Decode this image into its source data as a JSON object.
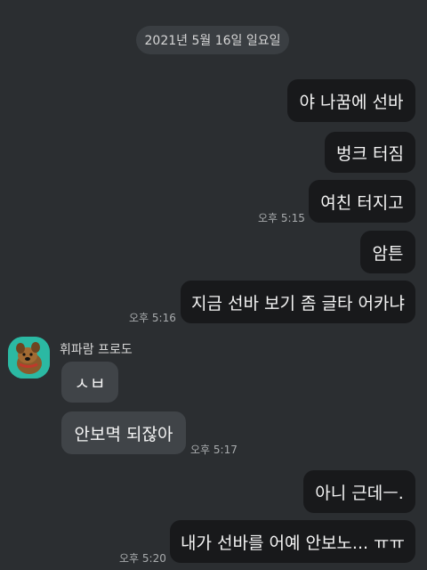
{
  "chat": {
    "date_separator": "2021년 5월 16일 일요일",
    "messages": [
      {
        "side": "right",
        "text": "야 나꿈에 선바"
      },
      {
        "side": "right",
        "text": "벙크 터짐"
      },
      {
        "side": "right",
        "text": "여친 터지고",
        "time": "오후 5:15"
      },
      {
        "side": "right",
        "text": "암튼"
      },
      {
        "side": "right",
        "text": "지금 선바 보기 좀 글타 어카냐",
        "time": "오후 5:16"
      },
      {
        "side": "left",
        "text": "ㅅㅂ"
      },
      {
        "side": "left",
        "text": "안보멱 되잖아",
        "time": "오후 5:17"
      },
      {
        "side": "right",
        "text": "아니 근데ㅡ."
      },
      {
        "side": "right",
        "text": "내가 선바를 어예 안보노... ㅠㅠ",
        "time": "오후 5:20"
      }
    ],
    "other_sender": {
      "name": "휘파람 프로도",
      "avatar_icon": "cartoon-dog-avatar-icon",
      "avatar_color": "#2bb9a3"
    }
  },
  "colors": {
    "background": "#2b2e31",
    "my_bubble": "#18191b",
    "their_bubble": "#404448",
    "timestamp": "#a8abad"
  }
}
